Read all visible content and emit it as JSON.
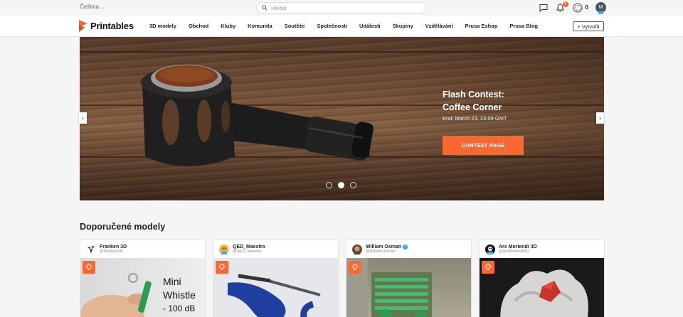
{
  "topbar": {
    "language": "Čeština",
    "search_placeholder": "Hledat",
    "notification_count": "7",
    "coins": "0",
    "user_initial": "M"
  },
  "navbar": {
    "brand": "Printables",
    "items": [
      "3D modely",
      "Obchod",
      "Kluby",
      "Komunita",
      "Soutěže",
      "Společnosti",
      "Události",
      "Skupiny",
      "Vzdělávání",
      "Prusa Eshop",
      "Prusa Blog"
    ],
    "create_label": "Vytvořit"
  },
  "hero": {
    "title_line1": "Flash Contest:",
    "title_line2": "Coffee Corner",
    "subtitle": "End: March 23, 23:59 GMT",
    "cta": "CONTEST PAGE",
    "slides": 3,
    "active_slide": 1
  },
  "recommended": {
    "title": "Doporučené modely",
    "cards": [
      {
        "author": "Franken 3D",
        "handle": "@Franken3D",
        "verified": false,
        "image_text_1": "Mini",
        "image_text_2": "Whistle",
        "image_text_3": "- 100 dB"
      },
      {
        "author": "QED_Maestro",
        "handle": "@QED_Maestro",
        "verified": false
      },
      {
        "author": "William Osman",
        "handle": "@WilliamOsman",
        "verified": true
      },
      {
        "author": "Ars Moriendi 3D",
        "handle": "@ArsMoriendi3D",
        "verified": false
      }
    ]
  },
  "colors": {
    "accent": "#fa6831",
    "verified": "#2fa8e0"
  }
}
